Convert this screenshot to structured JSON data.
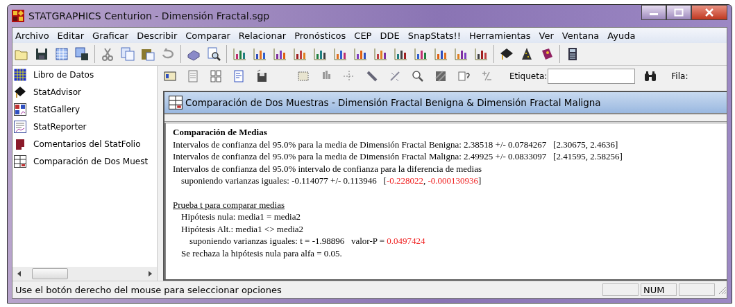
{
  "window": {
    "title": "STATGRAPHICS Centurion - Dimensión Fractal.sgp"
  },
  "menu": [
    "Archivo",
    "Editar",
    "Graficar",
    "Describir",
    "Comparar",
    "Relacionar",
    "Pronósticos",
    "CEP",
    "DDE",
    "SnapStats!!",
    "Herramientas",
    "Ver",
    "Ventana",
    "Ayuda"
  ],
  "sidebar": {
    "items": [
      {
        "label": "Libro de Datos",
        "kind": "data"
      },
      {
        "label": "StatAdvisor",
        "kind": "advisor"
      },
      {
        "label": "StatGallery",
        "kind": "gallery"
      },
      {
        "label": "StatReporter",
        "kind": "reporter"
      },
      {
        "label": "Comentarios del StatFolio",
        "kind": "comments"
      },
      {
        "label": "Comparación de Dos Muest",
        "kind": "analysis"
      }
    ]
  },
  "analysis_toolbar": {
    "label_field": {
      "label": "Etiqueta:"
    },
    "row_label": "Fila:"
  },
  "document": {
    "title": "Comparación de Dos Muestras - Dimensión Fractal Benigna & Dimensión Fractal Maligna",
    "sections": [
      {
        "title": "Comparación de Medias",
        "kind": "bold",
        "lines": [
          {
            "segments": [
              {
                "text": "Intervalos de confianza del 95.0% para la media de Dimensión Fractal Benigna: 2.38518 +/- 0.0784267   [2.30675, 2.4636]",
                "highlight": false
              }
            ]
          },
          {
            "segments": [
              {
                "text": "Intervalos de confianza del 95.0% para la media de Dimensión Fractal Maligna: 2.49925 +/- 0.0833097   [2.41595, 2.58256]",
                "highlight": false
              }
            ]
          },
          {
            "segments": [
              {
                "text": "Intervalos de confianza del 95.0% intervalo de confianza para la diferencia de medias",
                "highlight": false
              }
            ],
            "children": [
              {
                "segments": [
                  {
                    "text": "suponiendo varianzas iguales: -0.114077 +/- 0.113946   [",
                    "highlight": false
                  },
                  {
                    "text": "-0.228022",
                    "highlight": true
                  },
                  {
                    "text": ", ",
                    "highlight": false
                  },
                  {
                    "text": "-0.000130936",
                    "highlight": true
                  },
                  {
                    "text": "]",
                    "highlight": false
                  }
                ]
              }
            ]
          }
        ]
      },
      {
        "title": "Prueba t para comparar medias",
        "kind": "underline",
        "lines": [
          {
            "segments": [
              {
                "text": "Hipótesis nula: media1 = media2",
                "highlight": false
              }
            ]
          },
          {
            "segments": [
              {
                "text": "Hipótesis Alt.: media1 <> media2",
                "highlight": false
              }
            ],
            "children": [
              {
                "segments": [
                  {
                    "text": "suponiendo varianzas iguales: t = -1.98896   valor-P = ",
                    "highlight": false
                  },
                  {
                    "text": "0.0497424",
                    "highlight": true
                  }
                ]
              }
            ]
          },
          {
            "segments": [
              {
                "text": "Se rechaza la hipótesis nula para alfa = 0.05.",
                "highlight": false
              }
            ]
          }
        ]
      }
    ]
  },
  "status_bar": {
    "message": "Use el botón derecho del mouse para seleccionar opciones",
    "indicator": "NUM"
  }
}
